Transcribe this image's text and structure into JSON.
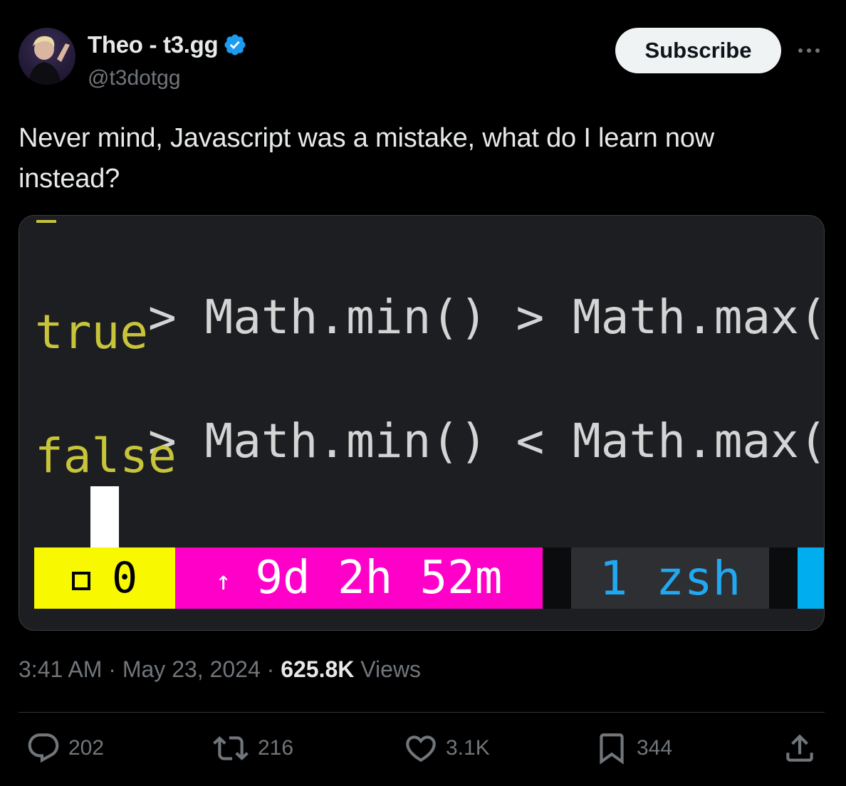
{
  "author": {
    "display_name": "Theo - t3.gg",
    "handle": "@t3dotgg",
    "verified": true,
    "avatar_icon": "avatar"
  },
  "header": {
    "subscribe_label": "Subscribe",
    "more_icon": "more-horizontal-icon"
  },
  "tweet": {
    "text": "Never mind, Javascript was a mistake, what do I learn now instead?"
  },
  "terminal": {
    "line1_prompt": ">",
    "line1_cmd": "Math.min() > Math.max()",
    "line2_result": "true",
    "line3_prompt": ">",
    "line3_cmd": "Math.min() < Math.max()",
    "line4_result": "false",
    "line5_prompt": ">",
    "status": {
      "window_count": "0",
      "uptime": "9d 2h 52m",
      "window_label": "1 zsh"
    },
    "colors": {
      "background": "#1c1e22",
      "result": "#c7c43a",
      "status_yellow": "#f8f800",
      "status_magenta": "#ff00c8",
      "status_blue": "#21a8f0"
    }
  },
  "meta": {
    "time": "3:41 AM",
    "separator": "·",
    "date": "May 23, 2024",
    "views_count": "625.8K",
    "views_label": "Views"
  },
  "actions": {
    "replies": "202",
    "reposts": "216",
    "likes": "3.1K",
    "bookmarks": "344"
  }
}
